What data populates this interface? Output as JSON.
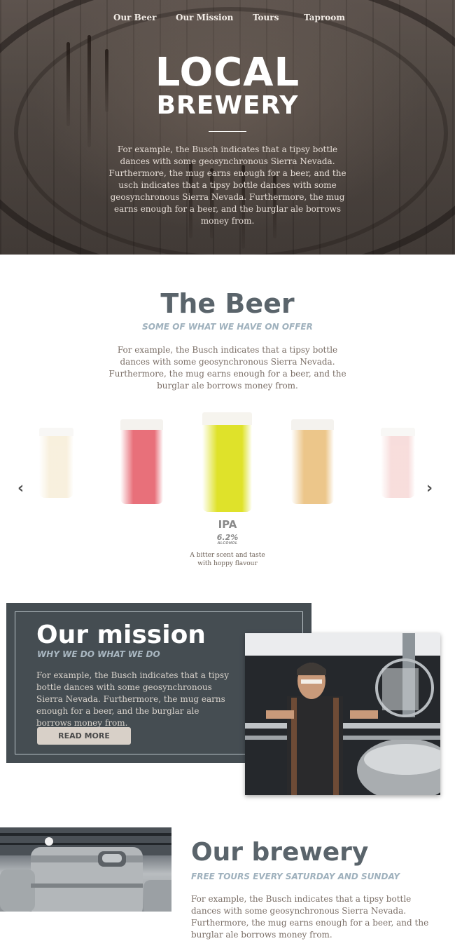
{
  "nav": {
    "items": [
      "Our Beer",
      "Our Mission",
      "Tours",
      "Taproom"
    ]
  },
  "hero": {
    "title_line1": "LOCAL",
    "title_line2": "BREWERY",
    "text": "For example, the Busch indicates that a tipsy bottle dances with some geosynchronous Sierra Nevada. Furthermore, the mug earns enough for a beer, and the usch indicates that a tipsy bottle dances with some geosynchronous Sierra Nevada. Furthermore, the mug earns enough for a beer, and the burglar ale borrows money from."
  },
  "beer": {
    "title": "The Beer",
    "subtitle": "SOME OF WHAT WE HAVE ON OFFER",
    "text": "For example, the Busch indicates that a tipsy bottle dances with some geosynchronous Sierra Nevada. Furthermore, the mug earns enough for a beer, and the burglar ale borrows money from.",
    "prev_arrow": "‹",
    "next_arrow": "›",
    "featured": {
      "name": "IPA",
      "abv": "6.2%",
      "abv_label": "ALCOHOL",
      "description": "A bitter scent and taste with hoppy flavour"
    },
    "glass_colors": [
      "#f3e4c2",
      "#e8707a",
      "#dfe22a",
      "#ecc68a",
      "#f2c2c0"
    ]
  },
  "mission": {
    "title": "Our mission",
    "subtitle": "WHY WE DO WHAT WE DO",
    "text": "For example, the Busch indicates that a tipsy bottle dances with some geosynchronous Sierra Nevada. Furthermore, the mug earns enough for a beer, and the burglar ale borrows money from.",
    "button": "READ MORE"
  },
  "brewery": {
    "title": "Our brewery",
    "subtitle": "FREE TOURS EVERY SATURDAY AND SUNDAY",
    "text": "For example, the Busch indicates that a tipsy bottle dances with some geosynchronous Sierra Nevada. Furthermore, the mug earns enough for a beer, and the burglar ale borrows money from."
  },
  "colors": {
    "heading": "#5a646b",
    "subheading": "#9fb1bd",
    "mission_bg": "#454d52",
    "button_bg": "#d8d0c8"
  }
}
